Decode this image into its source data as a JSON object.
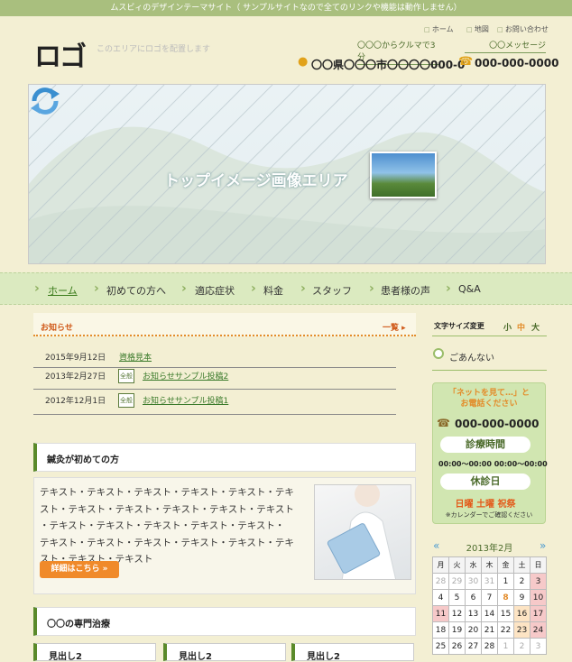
{
  "topbar": {
    "text": "ムスビィのデザインテーマサイト（ サンプルサイトなので全てのリンクや機能は動作しません）"
  },
  "header": {
    "logo": "ロゴ",
    "logo_note": "このエリアにロゴを配置します",
    "util_links": [
      "ホーム",
      "地図",
      "お問い合わせ"
    ],
    "tel_lead": "〇〇〇からクルマで3分",
    "msg_lead": "〇〇メッセージ",
    "address": "〇〇県〇〇〇市〇〇〇〇000-0",
    "tel": "000-000-0000"
  },
  "hero": {
    "text": "トップイメージ画像エリア"
  },
  "nav": {
    "items": [
      "ホーム",
      "初めての方へ",
      "適応症状",
      "料金",
      "スタッフ",
      "患者様の声",
      "Q&A"
    ]
  },
  "news": {
    "title": "お知らせ",
    "more": "一覧 ▸",
    "items": [
      {
        "date": "2015年9月12日",
        "tag": "",
        "title": "資格見本"
      },
      {
        "date": "2013年2月27日",
        "tag": "全般",
        "title": "お知らせサンプル投稿2"
      },
      {
        "date": "2012年12月1日",
        "tag": "全般",
        "title": "お知らせサンプル投稿1"
      }
    ]
  },
  "intro": {
    "title": "鍼灸が初めての方",
    "lines": [
      "テキスト・テキスト・テキスト・テキスト・テキスト・テキ",
      "スト・テキスト・テキスト・テキスト・テキスト・テキスト",
      "・テキスト・テキスト・テキスト・テキスト・テキスト・",
      "テキスト・テキスト・テキスト・テキスト・テキスト・テキ",
      "スト・テキスト・テキスト"
    ],
    "button": "詳細はこちら »"
  },
  "special": {
    "title": "〇〇の専門治療",
    "boxes": [
      "見出し2",
      "見出し2",
      "見出し2"
    ]
  },
  "sidebar": {
    "font_size_label": "文字サイズ変更",
    "font_sizes": [
      "小",
      "中",
      "大"
    ],
    "guide": "ごあんない",
    "banner": {
      "lead_line1": "「ネットを見て…」と",
      "lead_line2": "お電話ください",
      "tel": "000-000-0000",
      "hours_label": "診療時間",
      "hours": "00:00～00:00 00:00～00:00",
      "closed_label": "休診日",
      "closed_days": "日曜 土曜 祝祭",
      "note": "※カレンダーでご確認ください"
    }
  },
  "calendar": {
    "title": "2013年2月",
    "prev": "«",
    "next": "»",
    "weekdays": [
      "月",
      "火",
      "水",
      "木",
      "金",
      "土",
      "日"
    ],
    "rows": [
      [
        "28",
        "29",
        "30",
        "31",
        "1",
        "2",
        "3"
      ],
      [
        "4",
        "5",
        "6",
        "7",
        "8",
        "9",
        "10"
      ],
      [
        "11",
        "12",
        "13",
        "14",
        "15",
        "16",
        "17"
      ],
      [
        "18",
        "19",
        "20",
        "21",
        "22",
        "23",
        "24"
      ],
      [
        "25",
        "26",
        "27",
        "28",
        "1",
        "2",
        "3"
      ]
    ]
  },
  "colors": {
    "accent_green": "#5a8a2a",
    "accent_orange": "#e38c2a",
    "bg": "#f3efd3"
  }
}
